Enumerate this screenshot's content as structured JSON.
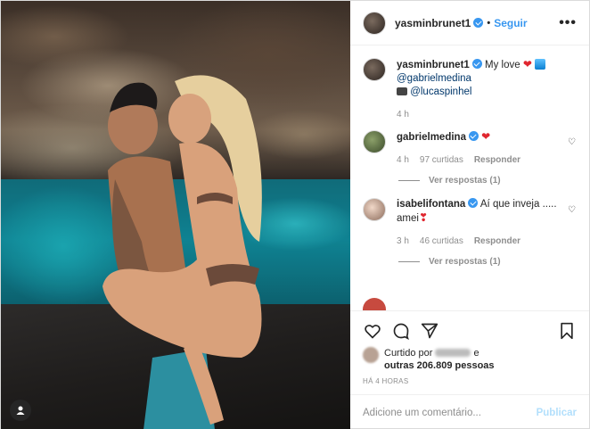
{
  "header": {
    "username": "yasminbrunet1",
    "separator": "•",
    "follow_label": "Seguir",
    "more_label": "•••"
  },
  "caption": {
    "username": "yasminbrunet1",
    "text": "My love",
    "mention1": "@gabrielmedina",
    "mention2": "@lucaspinhel",
    "time": "4 h"
  },
  "comments": [
    {
      "username": "gabrielmedina",
      "time": "4 h",
      "likes": "97 curtidas",
      "reply_label": "Responder",
      "view_replies": "Ver respostas (1)"
    },
    {
      "username": "isabelifontana",
      "text": "Aí que inveja .....",
      "text2": "amei",
      "time": "3 h",
      "likes": "46 curtidas",
      "reply_label": "Responder",
      "view_replies": "Ver respostas (1)"
    }
  ],
  "likes": {
    "prefix": "Curtido por",
    "suffix": "e",
    "others": "outras 206.809 pessoas"
  },
  "time_ago": "HÁ 4 HORAS",
  "comment_input": {
    "placeholder": "Adicione um comentário...",
    "publish_label": "Publicar"
  },
  "colors": {
    "accent": "#3897f0",
    "heart": "#e0262f",
    "publish_disabled": "#b2dffc"
  }
}
